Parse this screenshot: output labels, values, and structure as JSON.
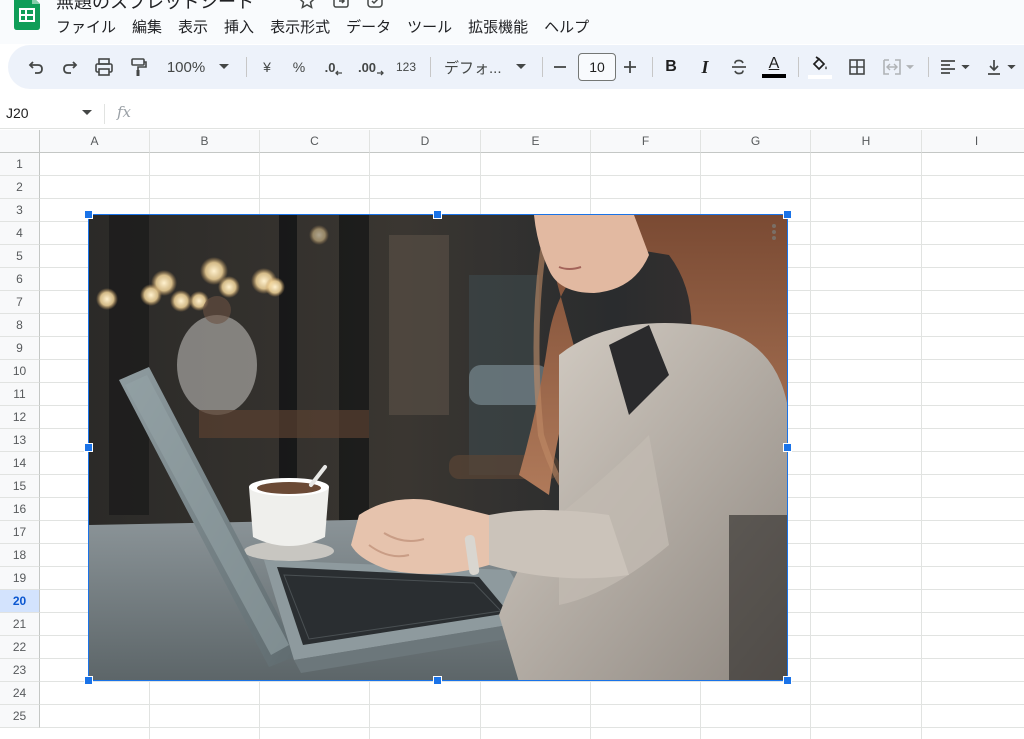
{
  "header": {
    "title": "無題のスプレッドシート",
    "menu": [
      "ファイル",
      "編集",
      "表示",
      "挿入",
      "表示形式",
      "データ",
      "ツール",
      "拡張機能",
      "ヘルプ"
    ]
  },
  "toolbar": {
    "zoom": "100%",
    "currency": "¥",
    "percent": "%",
    "decrease_decimal": ".0",
    "increase_decimal": ".00",
    "number_format": "123",
    "font": "デフォ...",
    "font_size": "10",
    "bold": "B",
    "italic": "I",
    "text_color_letter": "A"
  },
  "formula_bar": {
    "cell_ref": "J20",
    "fx": "fx",
    "value": ""
  },
  "grid": {
    "columns": [
      "A",
      "B",
      "C",
      "D",
      "E",
      "F",
      "G",
      "H",
      "I"
    ],
    "rows": [
      "1",
      "2",
      "3",
      "4",
      "5",
      "6",
      "7",
      "8",
      "9",
      "10",
      "11",
      "12",
      "13",
      "14",
      "15",
      "16",
      "17",
      "18",
      "19",
      "20",
      "21",
      "22",
      "23",
      "24",
      "25"
    ],
    "active_row": "20",
    "image": {
      "description_icon": "more-vertical-icon",
      "selected": true
    }
  },
  "colors": {
    "accent": "#1a73e8",
    "sheets_green": "#0f9d58",
    "toolbar_bg": "#edf2fa",
    "header_bg": "#f8f9fa",
    "grid_line": "#e1e3e1",
    "active_row_bg": "#d3e3fd"
  }
}
